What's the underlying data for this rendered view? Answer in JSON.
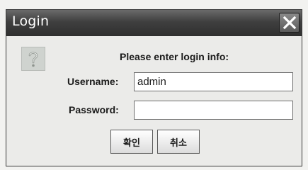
{
  "dialog": {
    "title": "Login",
    "prompt": "Please enter login info:",
    "username": {
      "label": "Username:",
      "value": "admin"
    },
    "password": {
      "label": "Password:",
      "value": ""
    },
    "buttons": {
      "ok_label": "확인",
      "cancel_label": "취소"
    },
    "icons": {
      "dialog_icon": "question-icon",
      "close_icon": "close-icon"
    }
  }
}
